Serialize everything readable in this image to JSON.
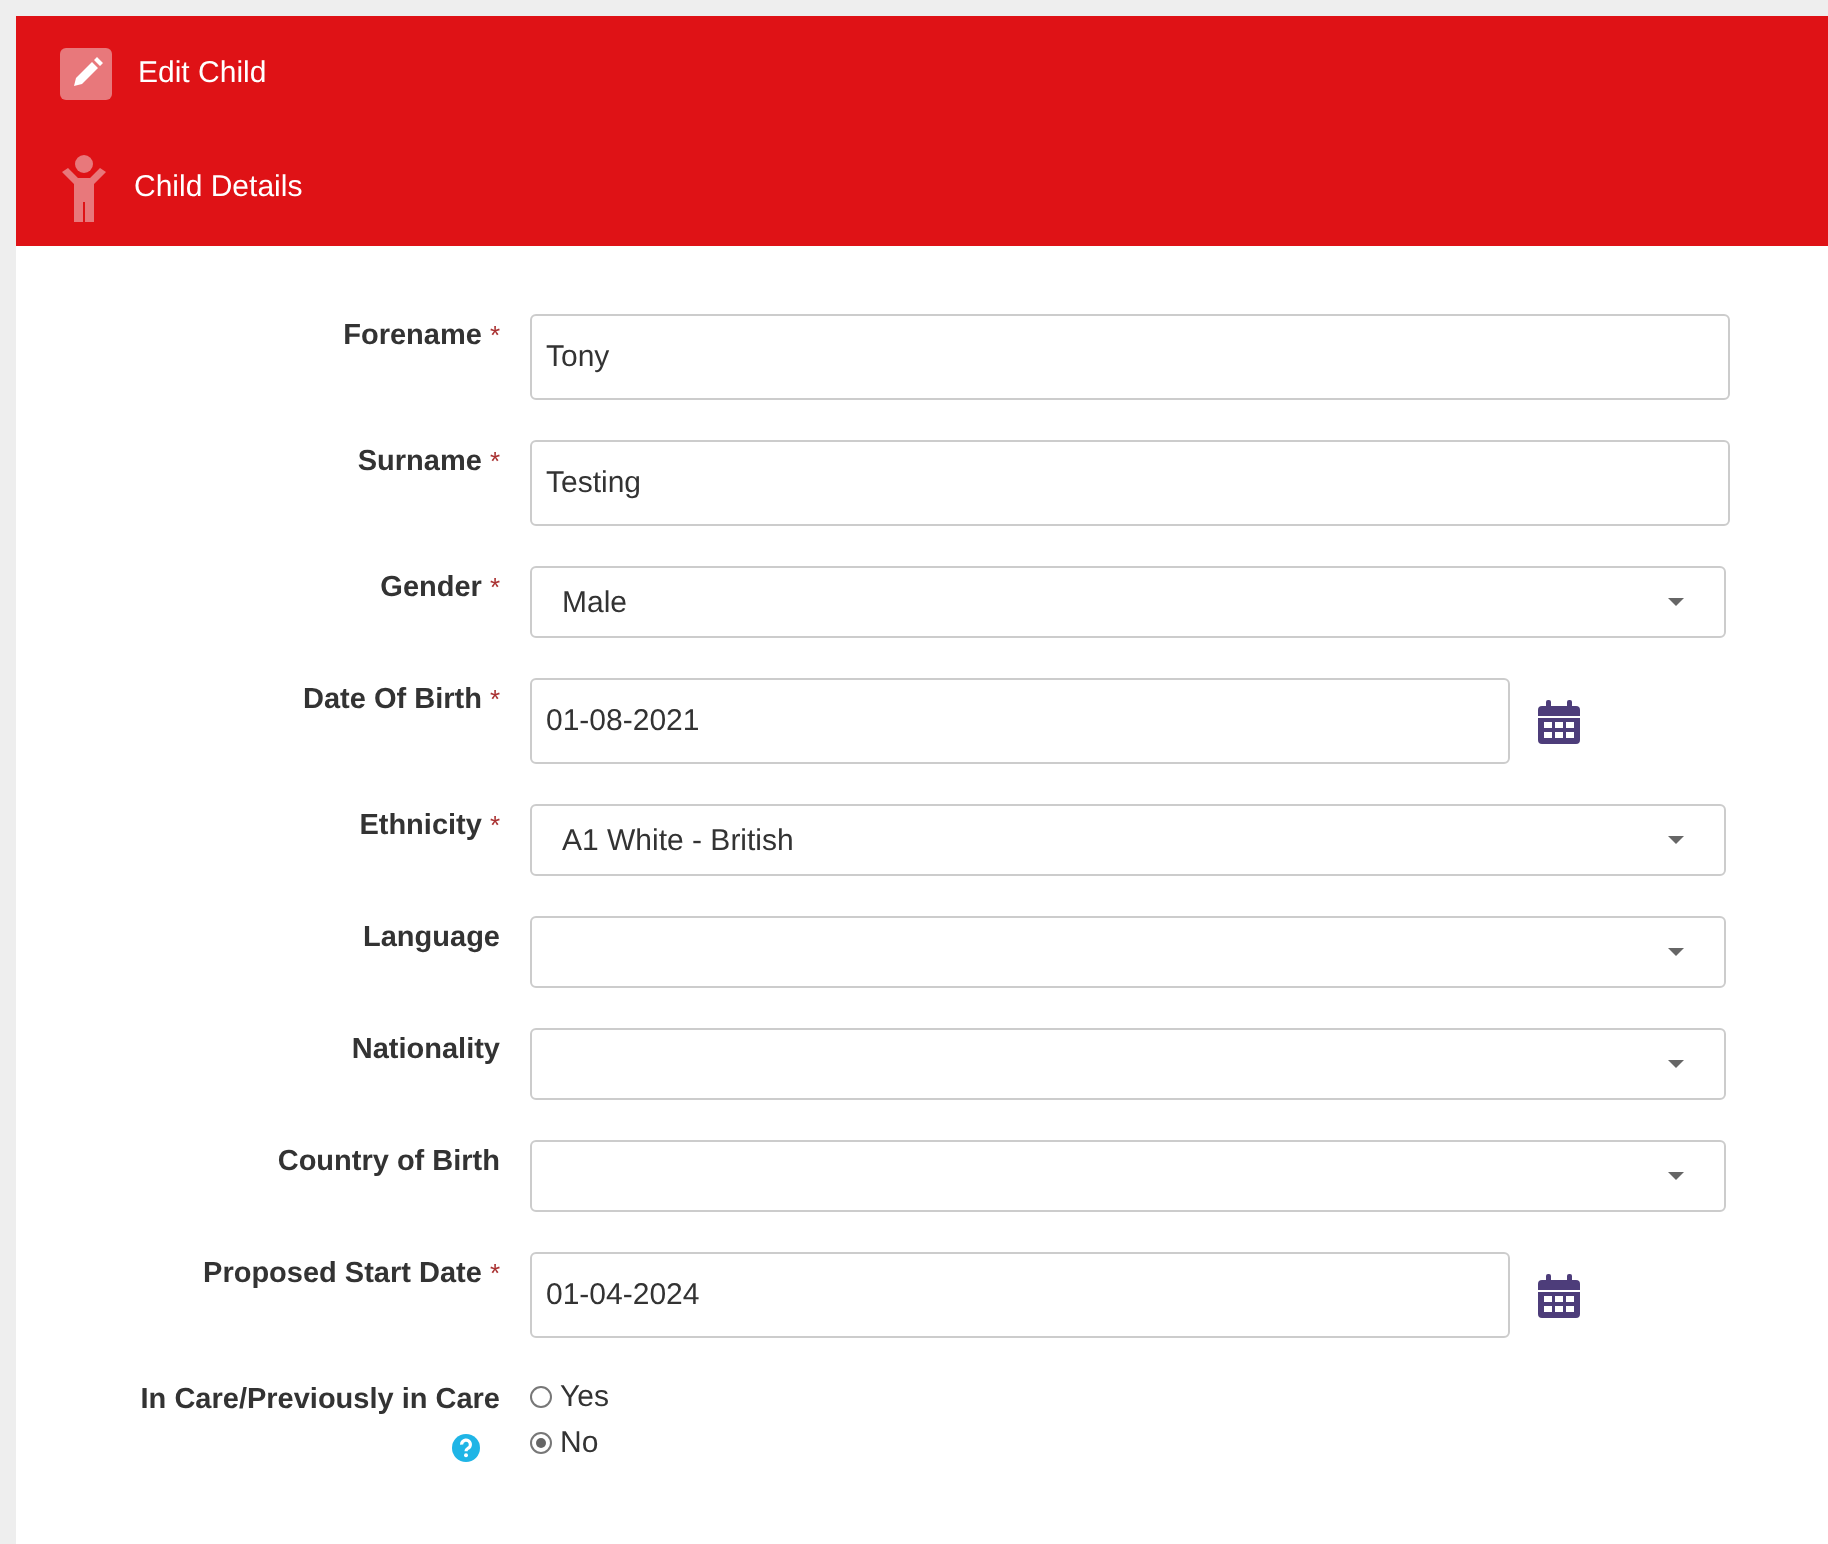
{
  "header": {
    "title": "Edit Child",
    "section": "Child Details"
  },
  "fields": [
    {
      "kind": "text",
      "label": "Forename",
      "required_mark": "*",
      "value": "Tony"
    },
    {
      "kind": "text",
      "label": "Surname",
      "required_mark": "*",
      "value": "Testing"
    },
    {
      "kind": "select",
      "label": "Gender",
      "required_mark": "*",
      "value": "Male"
    },
    {
      "kind": "date",
      "label": "Date Of Birth",
      "required_mark": "*",
      "value": "01-08-2021"
    },
    {
      "kind": "select",
      "label": "Ethnicity",
      "required_mark": "*",
      "value": "A1 White - British"
    },
    {
      "kind": "select",
      "label": "Language"
    },
    {
      "kind": "select",
      "label": "Nationality"
    },
    {
      "kind": "select",
      "label": "Country of Birth"
    },
    {
      "kind": "date",
      "label": "Proposed Start Date",
      "required_mark": "*",
      "value": "01-04-2024"
    },
    {
      "kind": "radio",
      "label": "In Care/Previously in Care",
      "help": true,
      "options": [
        {
          "label": "Yes",
          "selected": false
        },
        {
          "label": "No",
          "selected": true
        }
      ]
    }
  ]
}
